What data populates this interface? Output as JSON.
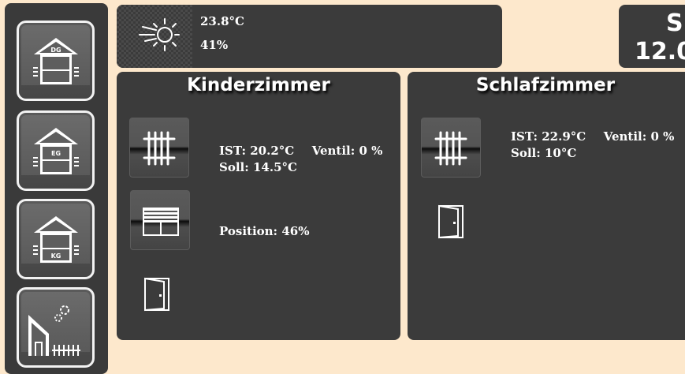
{
  "nav": [
    {
      "label": "DG",
      "icon": "house-dg-icon"
    },
    {
      "label": "EG",
      "icon": "house-eg-icon"
    },
    {
      "label": "KG",
      "icon": "house-kg-icon"
    },
    {
      "label": "",
      "icon": "garden-house-gears-icon"
    }
  ],
  "weather": {
    "icon": "sun-icon",
    "temperature": "23.8°C",
    "humidity": "41%"
  },
  "clock": {
    "line1": "S",
    "line2": "12.0"
  },
  "rooms": [
    {
      "title": "Kinderzimmer",
      "heating": {
        "ist": "IST: 20.2°C",
        "ventil": "Ventil: 0 %",
        "soll": "Soll: 14.5°C"
      },
      "blind": {
        "position": "Position: 46%"
      }
    },
    {
      "title": "Schlafzimmer",
      "heating": {
        "ist": "IST: 22.9°C",
        "ventil": "Ventil: 0 %",
        "soll": "Soll: 10°C"
      }
    }
  ],
  "colors": {
    "background": "#fde8cc",
    "panel": "#3b3b3b",
    "text": "#ffffff"
  }
}
